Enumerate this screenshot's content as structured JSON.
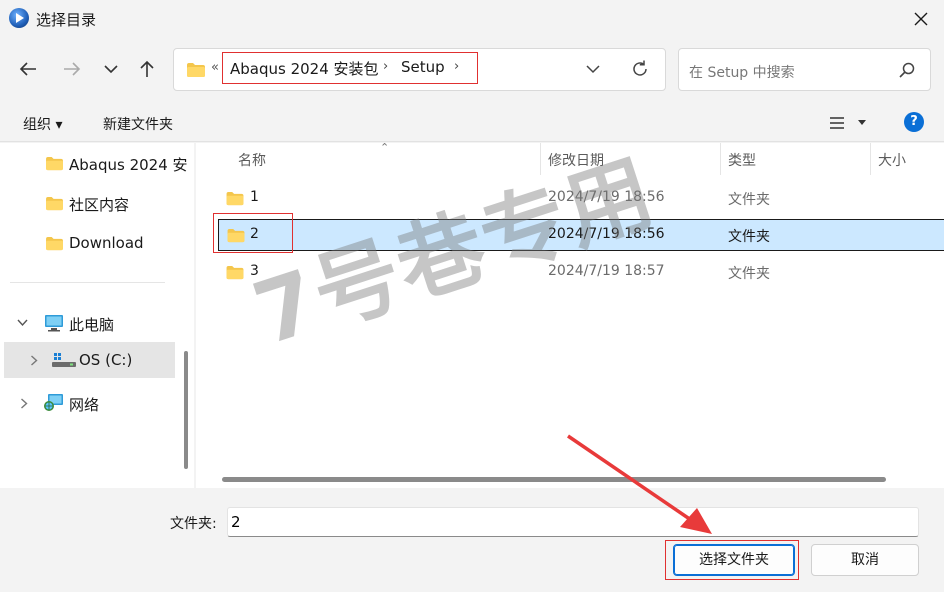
{
  "window": {
    "title": "选择目录",
    "close_symbol": "✕"
  },
  "address": {
    "overflow": "«",
    "crumbs": [
      "Abaqus 2024 安装包",
      "Setup"
    ],
    "separator": "›"
  },
  "search": {
    "placeholder": "在 Setup 中搜索"
  },
  "toolbar": {
    "organize": "组织 ▾",
    "new_folder": "新建文件夹",
    "help": "?"
  },
  "sidebar": {
    "quick": [
      "Abaqus 2024 安",
      "社区内容",
      "Download"
    ],
    "pc": "此电脑",
    "drive": "OS (C:)",
    "network": "网络"
  },
  "columns": {
    "name": "名称",
    "modified": "修改日期",
    "type": "类型",
    "size": "大小"
  },
  "files": [
    {
      "name": "1",
      "date": "2024/7/19 18:56",
      "type": "文件夹"
    },
    {
      "name": "2",
      "date": "2024/7/19 18:56",
      "type": "文件夹"
    },
    {
      "name": "3",
      "date": "2024/7/19 18:57",
      "type": "文件夹"
    }
  ],
  "bottom": {
    "folder_label": "文件夹:",
    "folder_value": "2",
    "select_btn": "选择文件夹",
    "cancel_btn": "取消"
  },
  "watermark": "7号巷专用",
  "colors": {
    "accent": "#0a6fd6",
    "selection": "#cce8ff",
    "annotation": "#e03030"
  }
}
